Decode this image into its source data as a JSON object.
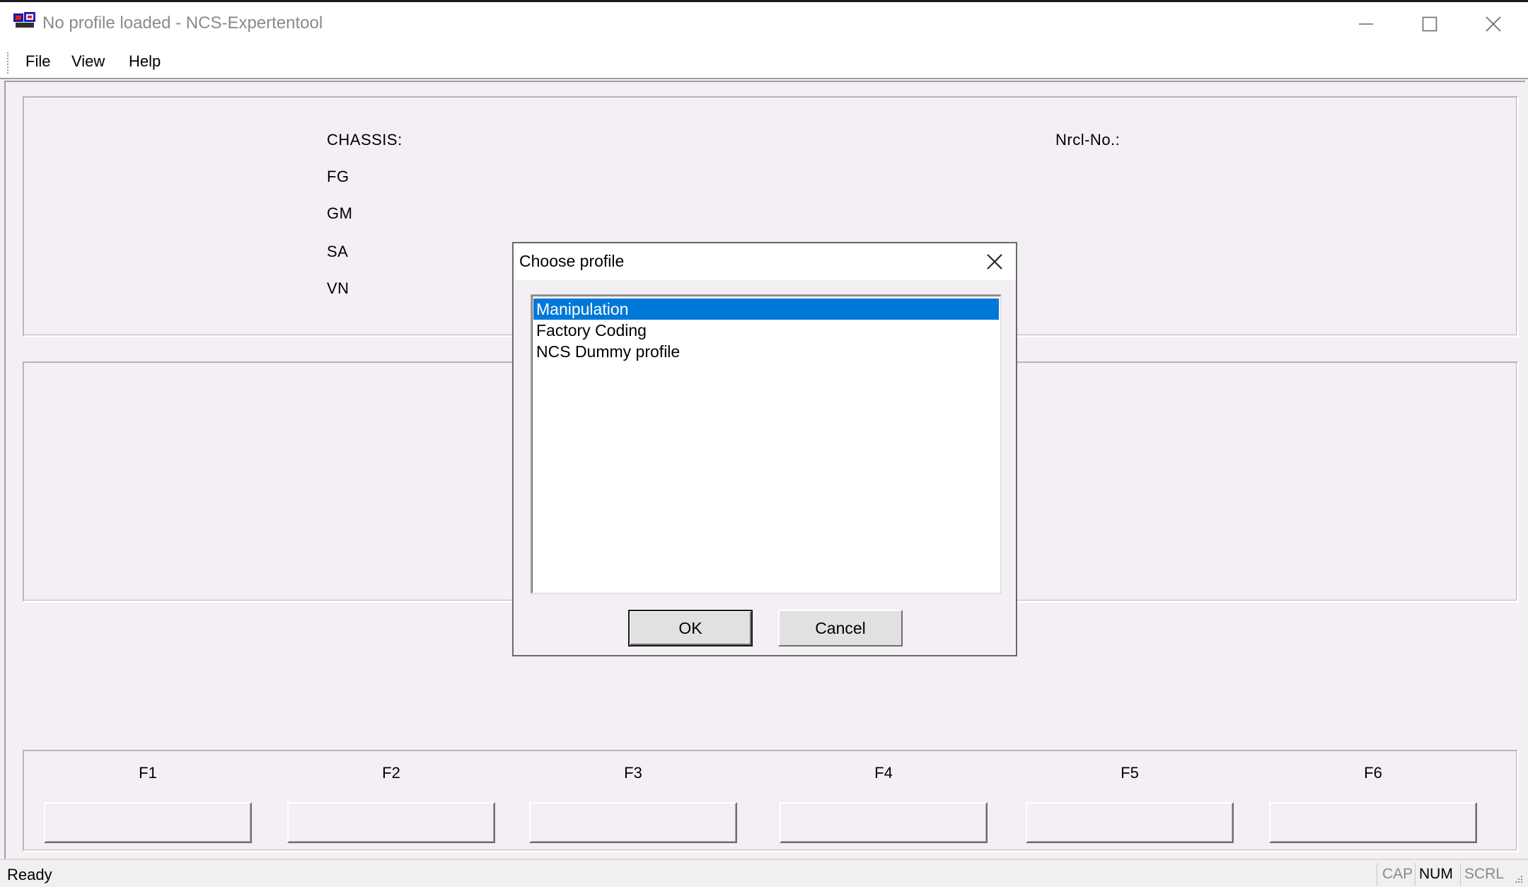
{
  "window": {
    "title": "No profile loaded - NCS-Expertentool",
    "icon": "ncs-app-icon",
    "controls": [
      "minimize-icon",
      "maximize-icon",
      "close-icon"
    ]
  },
  "menu": {
    "items": [
      {
        "label": "File"
      },
      {
        "label": "View"
      },
      {
        "label": "Help"
      }
    ]
  },
  "info": {
    "chassis_label": "CHASSIS:",
    "fg_label": "FG",
    "gm_label": "GM",
    "sa_label": "SA",
    "vn_label": "VN",
    "nrcl_label": "Nrcl-No.:"
  },
  "fkeys": [
    {
      "label": "F1"
    },
    {
      "label": "F2"
    },
    {
      "label": "F3"
    },
    {
      "label": "F4"
    },
    {
      "label": "F5"
    },
    {
      "label": "F6"
    }
  ],
  "dialog": {
    "title": "Choose profile",
    "profiles": [
      {
        "label": "Manipulation",
        "selected": true
      },
      {
        "label": "Factory Coding",
        "selected": false
      },
      {
        "label": "NCS Dummy profile",
        "selected": false
      }
    ],
    "ok_label": "OK",
    "cancel_label": "Cancel"
  },
  "status": {
    "text": "Ready",
    "cap": "CAP",
    "num": "NUM",
    "scrl": "SCRL"
  },
  "colors": {
    "selection": "#0078d7",
    "client_background": "#f4eff4",
    "title_text": "#8a8a8a"
  }
}
